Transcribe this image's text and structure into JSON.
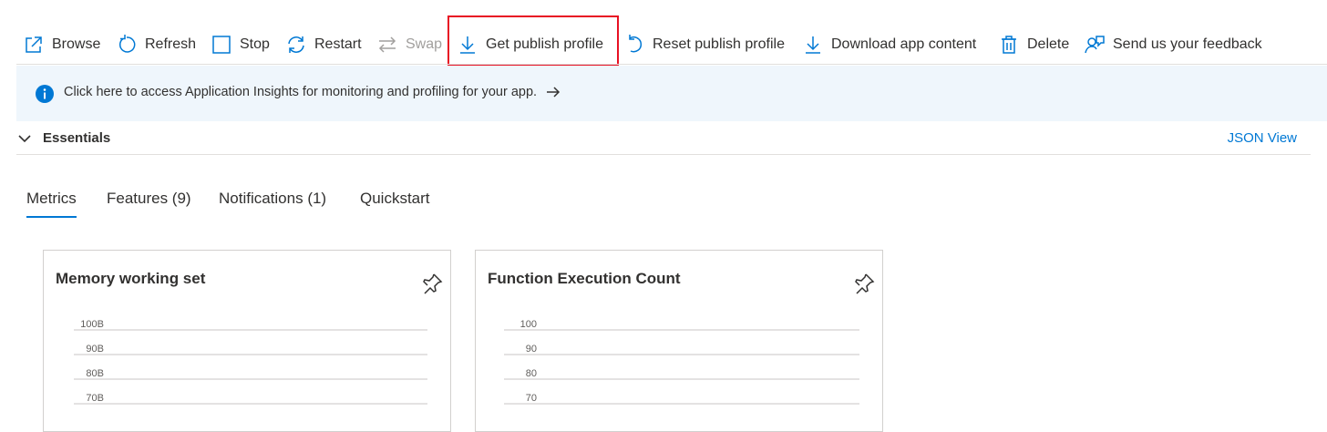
{
  "toolbar": {
    "browse": "Browse",
    "refresh": "Refresh",
    "stop": "Stop",
    "restart": "Restart",
    "swap": "Swap",
    "get_publish_profile": "Get publish profile",
    "reset_publish_profile": "Reset publish profile",
    "download_app_content": "Download app content",
    "delete": "Delete",
    "feedback": "Send us your feedback",
    "highlighted_item": "Get publish profile",
    "highlight_color": "#e81123"
  },
  "banner": {
    "text": "Click here to access Application Insights for monitoring and profiling for your app.",
    "icon": "info-icon",
    "color": "#0078d4"
  },
  "essentials": {
    "label": "Essentials",
    "json_view": "JSON View"
  },
  "tabs": [
    {
      "label": "Metrics",
      "active": true
    },
    {
      "label": "Features (9)",
      "active": false
    },
    {
      "label": "Notifications (1)",
      "active": false
    },
    {
      "label": "Quickstart",
      "active": false
    }
  ],
  "cards": [
    {
      "title": "Memory working set",
      "ticks": [
        "100B",
        "90B",
        "80B",
        "70B"
      ]
    },
    {
      "title": "Function Execution Count",
      "ticks": [
        "100",
        "90",
        "80",
        "70"
      ]
    }
  ],
  "colors": {
    "accent": "#0078d4",
    "banner_bg": "#eff6fc",
    "text": "#323130"
  }
}
